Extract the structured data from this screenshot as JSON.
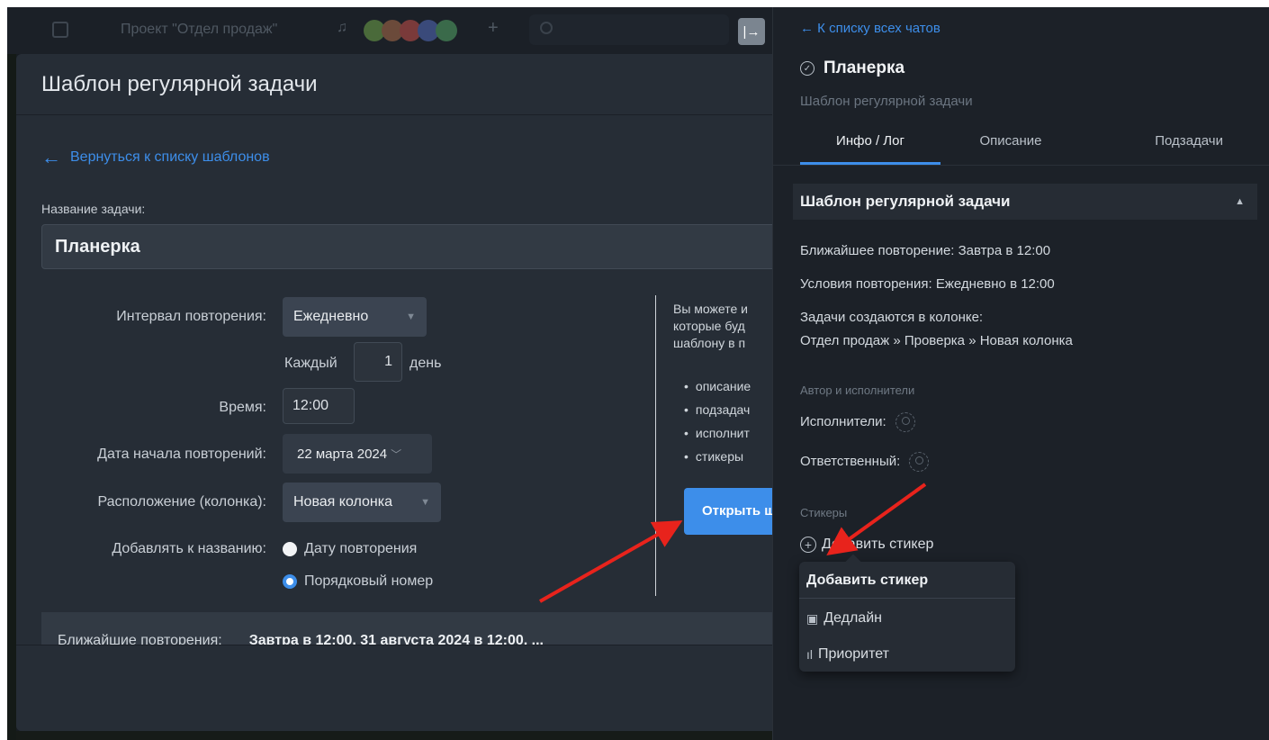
{
  "topbar": {
    "project_title": "Проект \"Отдел продаж\"",
    "collapse_glyph": "|→"
  },
  "modal": {
    "title": "Шаблон регулярной задачи",
    "back_link": "Вернуться к списку шаблонов",
    "name_label": "Название задачи:",
    "name_value": "Планерка",
    "interval_label": "Интервал повторения:",
    "interval_value": "Ежедневно",
    "each_label": "Каждый",
    "each_value": "1",
    "day_label": "день",
    "time_label": "Время:",
    "time_value": "12:00",
    "start_label": "Дата начала повторений:",
    "start_value": "22 марта 2024",
    "column_label": "Расположение (колонка):",
    "column_value": "Новая колонка",
    "append_label": "Добавлять к названию:",
    "radio_date": "Дату повторения",
    "radio_number": "Порядковый номер",
    "info_text_1": "Вы можете и",
    "info_text_2": "которые буд",
    "info_text_3": "шаблону в п",
    "info_items": [
      "описание",
      "подзадач",
      "исполнит",
      "стикеры"
    ],
    "open_button": "Открыть ш",
    "nearest_label": "Ближайшие повторения:",
    "nearest_value": "Завтра в 12:00, 31 августа 2024 в 12:00, ..."
  },
  "panel": {
    "back_link": "К списку всех чатов",
    "title": "Планерка",
    "subtitle": "Шаблон регулярной задачи",
    "tabs": [
      "Инфо / Лог",
      "Описание",
      "Подзадачи"
    ],
    "section_title": "Шаблон регулярной задачи",
    "next_repeat": "Ближайшее повторение: Завтра в 12:00",
    "repeat_conditions": "Условия повторения: Ежедневно в 12:00",
    "column_caption": "Задачи создаются в колонке:",
    "column_path": "Отдел продаж » Проверка » Новая колонка",
    "authors_heading": "Автор и исполнители",
    "executors_label": "Исполнители:",
    "responsible_label": "Ответственный:",
    "stickers_heading": "Стикеры",
    "add_sticker": "Добавить стикер",
    "dropdown": {
      "header": "Добавить стикер",
      "items": [
        "Дедлайн",
        "Приоритет"
      ]
    }
  },
  "colors": {
    "accent": "#3d8eea",
    "annotation_arrow": "#e8231c"
  }
}
